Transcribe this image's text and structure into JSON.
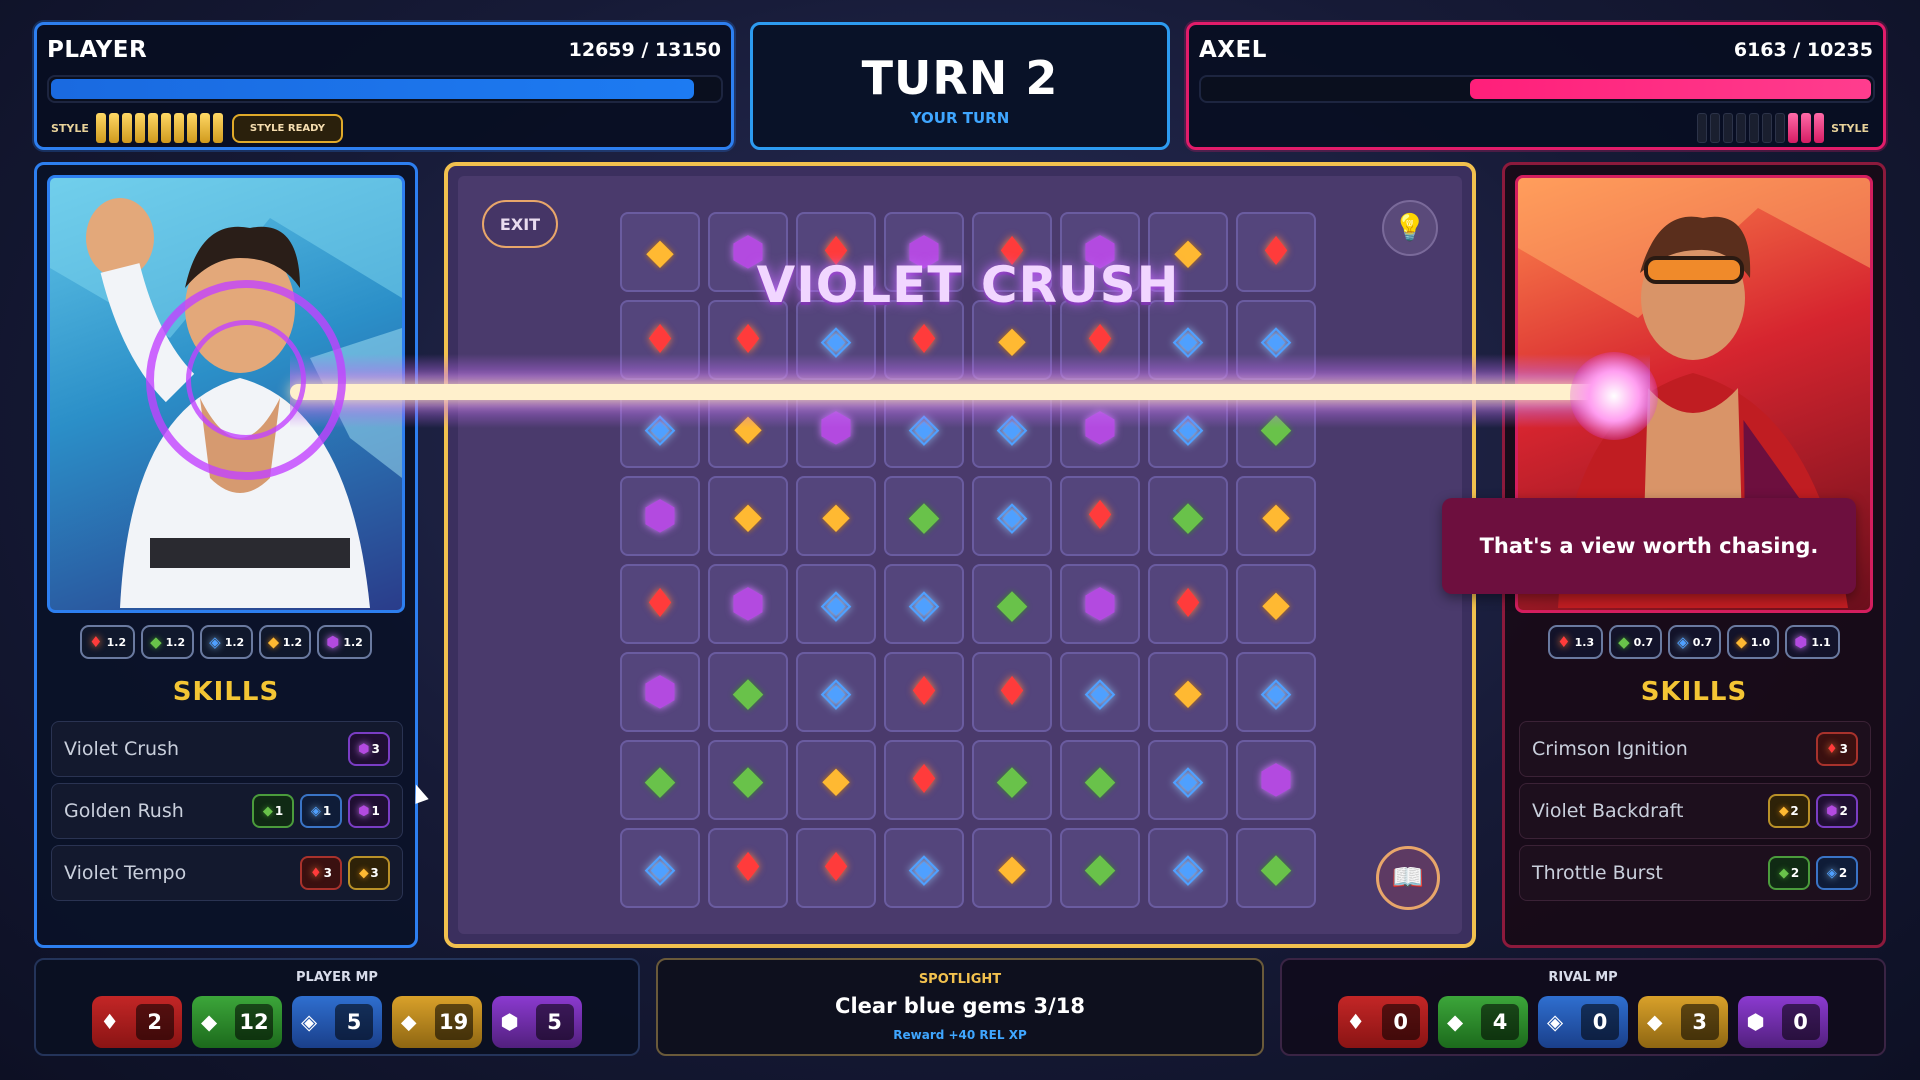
{
  "player": {
    "name": "PLAYER",
    "hp_text": "12659 / 13150",
    "hp_fraction": 0.9627,
    "style_label": "STYLE",
    "style_segments_filled": 10,
    "style_segments_total": 10,
    "style_ready_label": "STYLE READY",
    "multipliers": [
      {
        "gem": "red",
        "value": "1.2"
      },
      {
        "gem": "green",
        "value": "1.2"
      },
      {
        "gem": "blue",
        "value": "1.2"
      },
      {
        "gem": "gold",
        "value": "1.2"
      },
      {
        "gem": "violet",
        "value": "1.2"
      }
    ],
    "skills_header": "SKILLS",
    "skills": [
      {
        "name": "Violet Crush",
        "costs": [
          {
            "gem": "violet",
            "n": "3"
          }
        ]
      },
      {
        "name": "Golden Rush",
        "costs": [
          {
            "gem": "green",
            "n": "1"
          },
          {
            "gem": "blue",
            "n": "1"
          },
          {
            "gem": "violet",
            "n": "1"
          }
        ]
      },
      {
        "name": "Violet Tempo",
        "costs": [
          {
            "gem": "red",
            "n": "3"
          },
          {
            "gem": "gold",
            "n": "3"
          }
        ]
      }
    ],
    "mp_header": "PLAYER MP",
    "mp": [
      {
        "gem": "red",
        "value": "2"
      },
      {
        "gem": "green",
        "value": "12"
      },
      {
        "gem": "blue",
        "value": "5"
      },
      {
        "gem": "gold",
        "value": "19"
      },
      {
        "gem": "violet",
        "value": "5"
      }
    ]
  },
  "rival": {
    "name": "AXEL",
    "hp_text": "6163 / 10235",
    "hp_fraction": 0.6022,
    "style_label": "STYLE",
    "style_segments_filled": 3,
    "style_segments_total": 10,
    "speech": "That's a view worth chasing.",
    "multipliers": [
      {
        "gem": "red",
        "value": "1.3"
      },
      {
        "gem": "green",
        "value": "0.7"
      },
      {
        "gem": "blue",
        "value": "0.7"
      },
      {
        "gem": "gold",
        "value": "1.0"
      },
      {
        "gem": "violet",
        "value": "1.1"
      }
    ],
    "skills_header": "SKILLS",
    "skills": [
      {
        "name": "Crimson Ignition",
        "costs": [
          {
            "gem": "red",
            "n": "3"
          }
        ]
      },
      {
        "name": "Violet Backdraft",
        "costs": [
          {
            "gem": "gold",
            "n": "2"
          },
          {
            "gem": "violet",
            "n": "2"
          }
        ]
      },
      {
        "name": "Throttle Burst",
        "costs": [
          {
            "gem": "green",
            "n": "2"
          },
          {
            "gem": "blue",
            "n": "2"
          }
        ]
      }
    ],
    "mp_header": "RIVAL MP",
    "mp": [
      {
        "gem": "red",
        "value": "0"
      },
      {
        "gem": "green",
        "value": "4"
      },
      {
        "gem": "blue",
        "value": "0"
      },
      {
        "gem": "gold",
        "value": "3"
      },
      {
        "gem": "violet",
        "value": "0"
      }
    ]
  },
  "turn": {
    "title": "TURN 2",
    "subtitle": "YOUR TURN"
  },
  "board": {
    "exit_label": "EXIT",
    "hint_icon": "lightbulb-icon",
    "spellbook_icon": "spellbook-icon",
    "combo_text": "VIOLET CRUSH",
    "grid": [
      [
        "gold",
        "violet",
        "red",
        "violet",
        "red",
        "violet",
        "gold",
        "red"
      ],
      [
        "red",
        "red",
        "blue",
        "red",
        "gold",
        "red",
        "blue",
        "blue"
      ],
      [
        "blue",
        "gold",
        "violet",
        "blue",
        "blue",
        "violet",
        "blue",
        "green"
      ],
      [
        "violet",
        "gold",
        "gold",
        "green",
        "blue",
        "red",
        "green",
        "gold"
      ],
      [
        "red",
        "violet",
        "blue",
        "blue",
        "green",
        "violet",
        "red",
        "gold"
      ],
      [
        "violet",
        "green",
        "blue",
        "red",
        "red",
        "blue",
        "gold",
        "blue"
      ],
      [
        "green",
        "green",
        "gold",
        "red",
        "green",
        "green",
        "blue",
        "violet"
      ],
      [
        "blue",
        "red",
        "red",
        "blue",
        "gold",
        "green",
        "blue",
        "green"
      ]
    ]
  },
  "spotlight": {
    "header": "SPOTLIGHT",
    "task": "Clear blue gems  3/18",
    "reward": "Reward +40 REL XP"
  },
  "gem_glyphs": {
    "red": "♦",
    "green": "◆",
    "blue": "◈",
    "gold": "⬥",
    "violet": "⬢"
  },
  "colors": {
    "player_hp": "#1d7bf2",
    "rival_hp": "#ff1f7a",
    "accent_gold": "#f2c14e",
    "beam": "#c242ff"
  }
}
